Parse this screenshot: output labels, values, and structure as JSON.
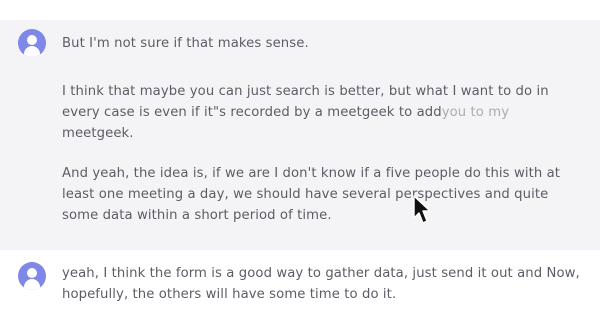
{
  "messages": [
    {
      "avatar": "user-avatar-icon",
      "paragraphs": [
        {
          "text": "But I'm not sure if that makes sense."
        },
        {
          "text": "I think that maybe you can just search is better, but what I want to do in every case is even if it\"s recorded by a meetgeek to add",
          "ghost": "you to my",
          "tail": " meetgeek."
        },
        {
          "text": "And yeah, the idea is, if we are I don't know if a five people do this with at least one meeting a day, we should have several perspectives and quite some data within a short period of time."
        }
      ]
    },
    {
      "avatar": "user-avatar-icon",
      "paragraphs": [
        {
          "text": "yeah, I think the form is a good way to gather data, just send it out and Now, hopefully, the others will have some time to do it."
        }
      ]
    }
  ],
  "colors": {
    "avatar": "#7f87e9",
    "text": "#5c5c66",
    "highlight_bg": "#f4f4f6"
  },
  "cursor_icon": "mouse-pointer-icon"
}
